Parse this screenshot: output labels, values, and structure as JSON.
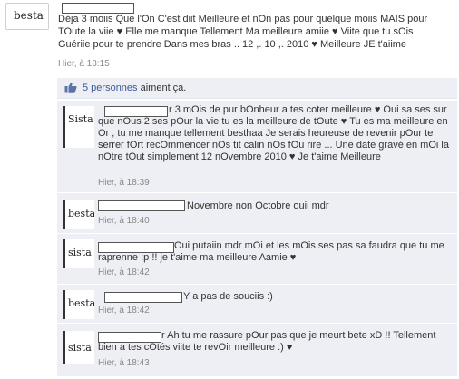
{
  "post": {
    "author_avatar_label": "besta",
    "text": "Déja 3 moiis Que l'On C'est diit Meilleure et nOn pas pour quelque moiis MAIS pour TOute la viie ♥ Elle me manque Tellement Ma meilleure amiie ♥ Viite que tu sOis Guériie pour te prendre Dans mes bras .. 12 ,. 10 ,. 2010 ♥ Meilleure JE t'aiime",
    "timestamp": "Hier, à 18:15"
  },
  "likes": {
    "count_link": "5 personnes",
    "suffix": "aiment ça."
  },
  "comments": [
    {
      "avatar_label": "Sista",
      "text": "r 3 mOis de pur bOnheur a tes coter meilleure ♥ Oui sa ses sur que nOus 2 ses pOur la vie tu es la meilleure de tOute ♥ Tu es ma meilleure en Or , tu me manque tellement besthaa Je serais heureuse de revenir pOur te serrer fOrt recOmmencer nOs tit calin nOs fOu rire ... Une date gravé en mOi la nOtre tOut simplement 12 nOvembre 2010 ♥ Je t'aime Meilleure",
      "timestamp": "Hier, à 18:39"
    },
    {
      "avatar_label": "besta",
      "text": "Novembre non Octobre ouii mdr",
      "timestamp": "Hier, à 18:40"
    },
    {
      "avatar_label": "sista",
      "text": "Oui putaiin mdr mOi et les mOis ses pas sa faudra que tu me raprenne :p !! je t'aime ma meilleure Aamie ♥",
      "timestamp": "Hier, à 18:42"
    },
    {
      "avatar_label": "besta",
      "text": "Y a pas de souciis :)",
      "timestamp": "Hier, à 18:42"
    },
    {
      "avatar_label": "sista",
      "text": "r Ah tu me rassure pOur pas que je meurt bete xD !! Tellement bien a tes cOtés viite te revOir meilleure :) ♥",
      "timestamp": "Hier, à 18:43"
    }
  ],
  "colors": {
    "link": "#3b5998",
    "ufi_background": "#edeff4",
    "timestamp": "#888888"
  },
  "icons": {
    "like": "thumbs-up-icon"
  }
}
